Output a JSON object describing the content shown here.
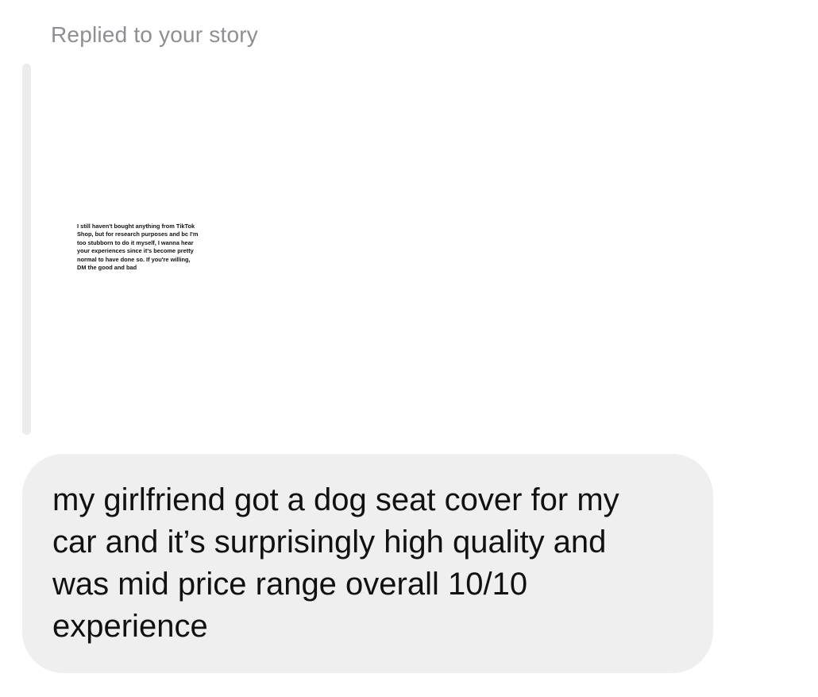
{
  "reply_context": {
    "label": "Replied to your story"
  },
  "story": {
    "text": "I still haven't bought anything from TikTok\nShop, but for research purposes and bc I'm\ntoo stubborn to do it myself, I wanna hear\nyour experiences since it's become pretty\nnormal to have done so. If you're willing,\nDM the good and bad"
  },
  "message": {
    "text": "my girlfriend got a dog seat cover for my\ncar and it’s surprisingly high quality and\nwas mid price range overall 10/10\nexperience"
  },
  "colors": {
    "label": "#8e8e93",
    "bubble_background": "#efefef",
    "story_bar": "#ececec",
    "text": "#111111"
  }
}
